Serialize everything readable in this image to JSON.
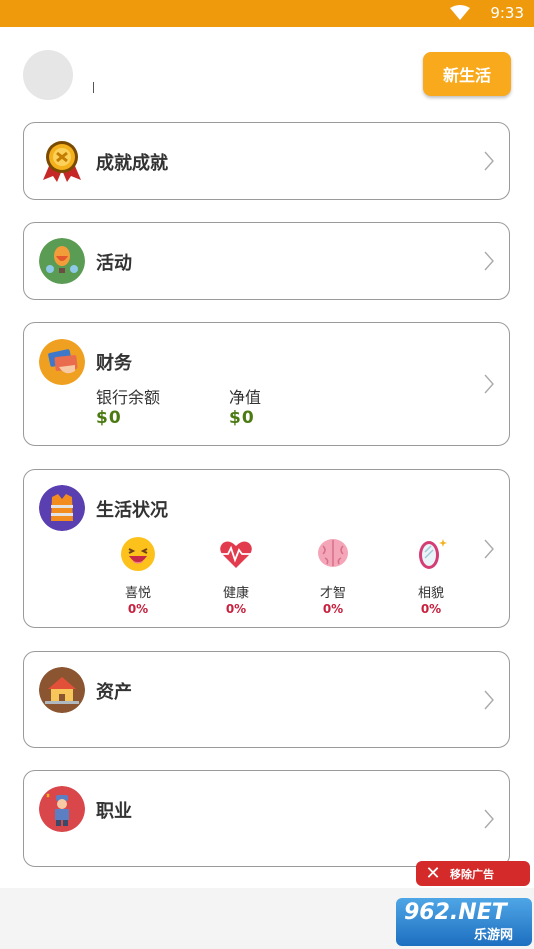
{
  "status_bar": {
    "time": "9:33"
  },
  "header": {
    "new_life_label": "新生活"
  },
  "cards": {
    "achievements": {
      "title": "成就成就"
    },
    "activities": {
      "title": "活动"
    },
    "finance": {
      "title": "财务",
      "bank_label": "银行余额",
      "bank_value": "$0",
      "net_label": "净值",
      "net_value": "$0"
    },
    "life_status": {
      "title": "生活状况",
      "stats": [
        {
          "label": "喜悦",
          "value": "0%"
        },
        {
          "label": "健康",
          "value": "0%"
        },
        {
          "label": "才智",
          "value": "0%"
        },
        {
          "label": "相貌",
          "value": "0%"
        }
      ]
    },
    "assets": {
      "title": "资产"
    },
    "career": {
      "title": "职业"
    }
  },
  "ad": {
    "remove_label": "移除广告"
  },
  "watermark": {
    "brand": "962.NET",
    "sub": "乐游网"
  },
  "colors": {
    "accent": "#ef9a0c",
    "button": "#f8a91c",
    "money": "#4b7a12",
    "percent": "#c8213e"
  }
}
